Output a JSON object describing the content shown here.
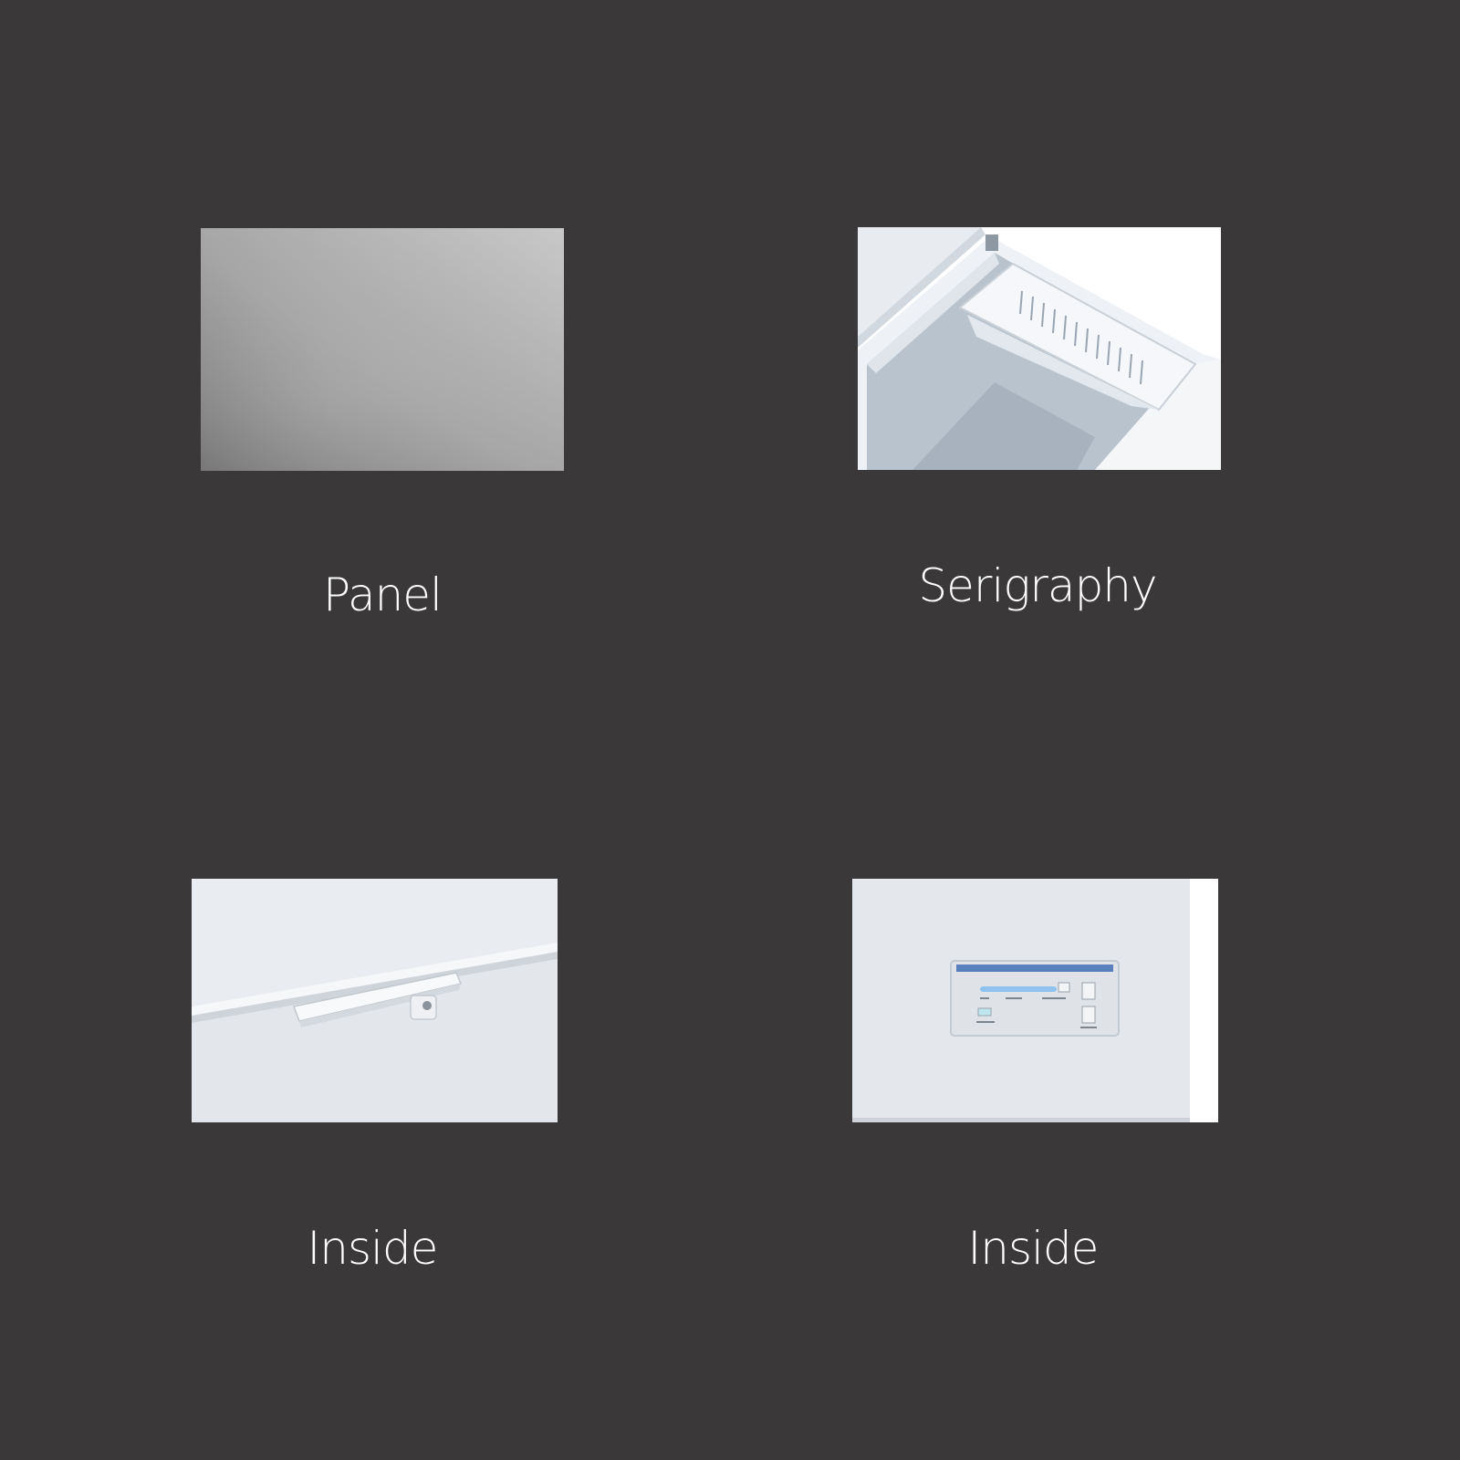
{
  "background_color": "#3a3839",
  "tiles": [
    {
      "id": "panel",
      "caption": "Panel",
      "image_subject": "brushed-metal-panel"
    },
    {
      "id": "basket",
      "caption": "Serigraphy",
      "image_subject": "freezer-interior-with-basket"
    },
    {
      "id": "handle",
      "caption": "Inside",
      "image_subject": "freezer-lid-handle"
    },
    {
      "id": "control",
      "caption": "Inside",
      "image_subject": "freezer-control-panel"
    }
  ]
}
